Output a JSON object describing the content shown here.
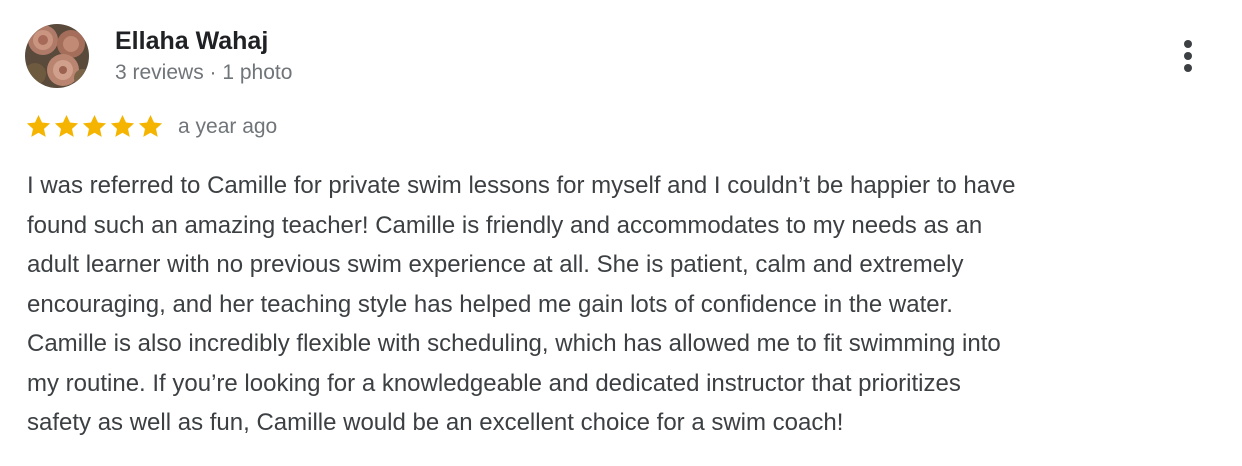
{
  "review": {
    "author": {
      "name": "Ellaha Wahaj",
      "meta": "3 reviews · 1 photo",
      "avatar_icon": "rose-photo-avatar"
    },
    "rating": 5,
    "rating_max": 5,
    "star_color": "#f5b400",
    "date": "a year ago",
    "menu_icon": "more-vert-icon",
    "text_lines": [
      "I was referred to Camille for private swim lessons for myself and I couldn’t be happier to have",
      "found such an amazing teacher! Camille is friendly and accommodates to my needs as an",
      "adult learner with no previous swim experience at all. She is patient, calm and extremely",
      "encouraging, and her teaching style has helped me gain lots of confidence in the water.",
      "Camille is also incredibly flexible with scheduling, which has allowed me to fit swimming into",
      "my routine. If you’re looking for a knowledgeable and dedicated instructor that prioritizes",
      "safety as well as fun, Camille would be an excellent choice for a swim coach!"
    ]
  }
}
